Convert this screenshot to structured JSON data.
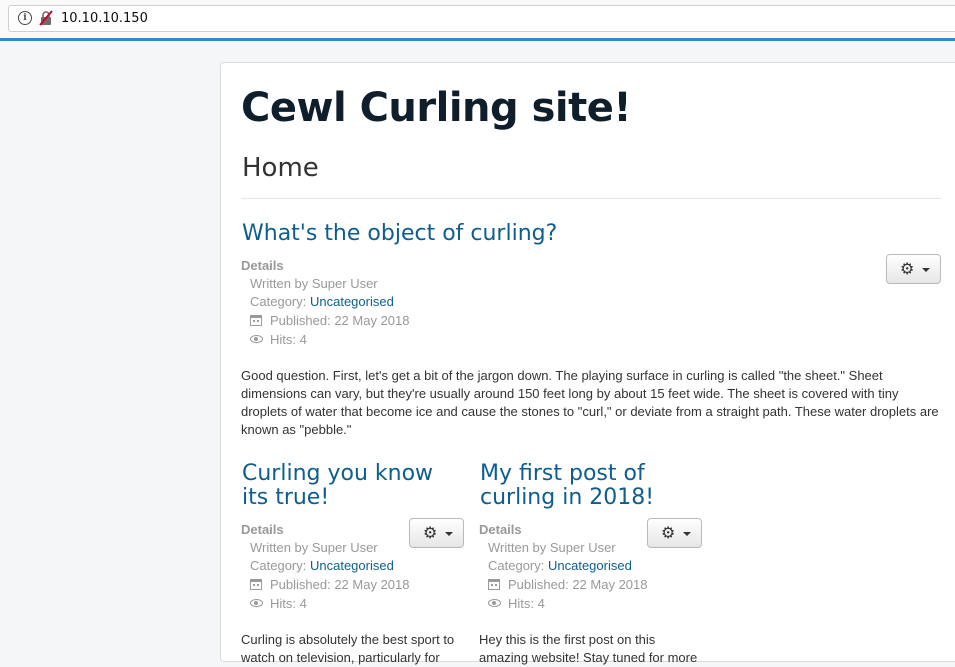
{
  "browser": {
    "url": "10.10.10.150"
  },
  "site": {
    "title": "Cewl Curling site!",
    "page_heading": "Home"
  },
  "articles": [
    {
      "title": "What's the object of curling?",
      "details_label": "Details",
      "written_by": "Written by Super User",
      "category_label": "Category: ",
      "category": "Uncategorised",
      "published": "Published: 22 May 2018",
      "hits": "Hits: 4",
      "body": "Good question. First, let's get a bit of the jargon down. The playing surface in curling is called \"the sheet.\" Sheet dimensions can vary, but they're usually around 150 feet long by about 15 feet wide. The sheet is covered with tiny droplets of water that become ice and cause the stones to \"curl,\" or deviate from a straight path. These water droplets are known as \"pebble.\""
    },
    {
      "title_line1": "Curling you know",
      "title_line2": "its true!",
      "details_label": "Details",
      "written_by": "Written by Super User",
      "category_label": "Category: ",
      "category": "Uncategorised",
      "published": "Published: 22 May 2018",
      "hits": "Hits: 4",
      "body_line1": "Curling is absolutely the best sport to",
      "body_line2": "watch on television, particularly for"
    },
    {
      "title_line1": "My first post of",
      "title_line2": "curling in 2018!",
      "details_label": "Details",
      "written_by": "Written by Super User",
      "category_label": "Category: ",
      "category": "Uncategorised",
      "published": "Published: 22 May 2018",
      "hits": "Hits: 4",
      "body_line1": "Hey this is the first post on this",
      "body_line2": "amazing website! Stay tuned for more"
    }
  ],
  "icons": {
    "info": "info-icon",
    "insecure": "insecure-connection-icon",
    "gear": "gear-icon",
    "caret": "caret-down-icon",
    "calendar": "calendar-icon",
    "eye": "eye-icon"
  }
}
